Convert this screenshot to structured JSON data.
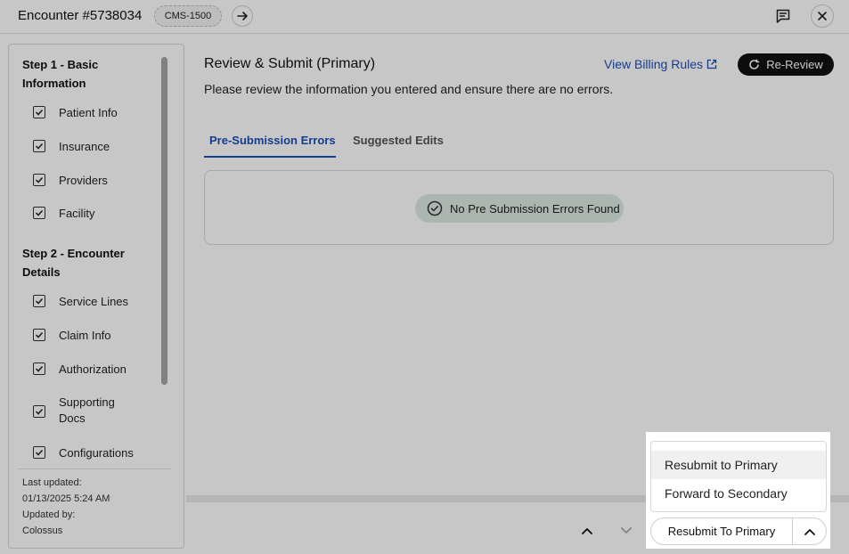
{
  "header": {
    "title": "Encounter #5738034",
    "badge": "CMS-1500"
  },
  "sidebar": {
    "step1_title": "Step 1 - Basic Information",
    "step1_items": [
      "Patient Info",
      "Insurance",
      "Providers",
      "Facility"
    ],
    "step2_title": "Step 2 - Encounter Details",
    "step2_items": [
      "Service Lines",
      "Claim Info",
      "Authorization",
      "Supporting Docs",
      "Configurations"
    ],
    "last_updated_label": "Last updated:",
    "last_updated_value": "01/13/2025 5:24 AM",
    "updated_by_label": "Updated by:",
    "updated_by_value": "Colossus"
  },
  "main": {
    "title": "Review & Submit (Primary)",
    "subtitle": "Please review the information you entered and ensure there are no errors.",
    "billing_link": "View Billing Rules",
    "rereview_label": "Re-Review",
    "tabs": [
      "Pre-Submission Errors",
      "Suggested Edits"
    ],
    "status_message": "No Pre Submission Errors Found"
  },
  "submit_menu": {
    "options": [
      "Resubmit to Primary",
      "Forward to Secondary"
    ],
    "button_label": "Resubmit To Primary"
  },
  "colors": {
    "accent": "#1e4fb8",
    "success_bg": "#dde9e2",
    "dark_button": "#111111"
  }
}
